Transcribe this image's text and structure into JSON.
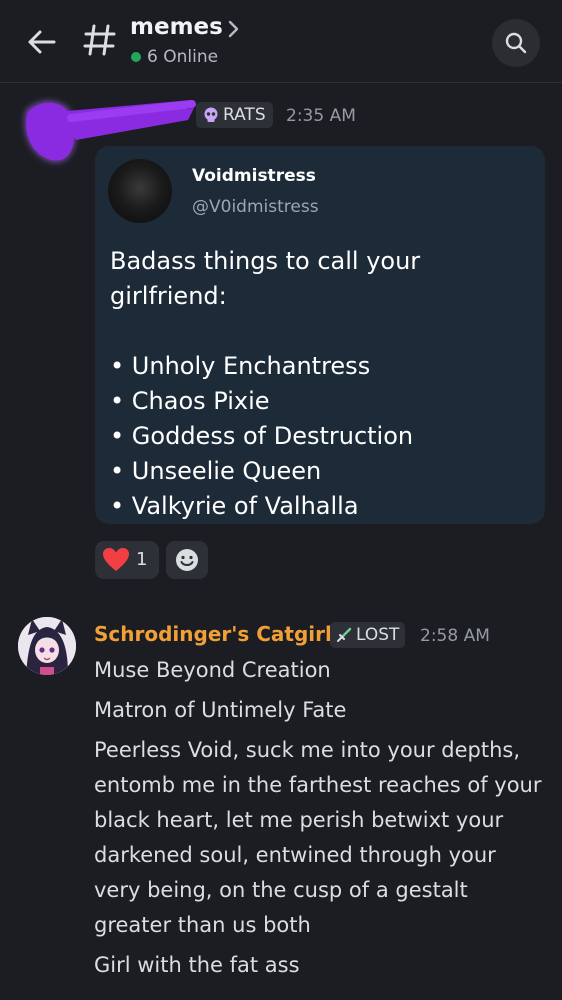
{
  "header": {
    "channel_name": "memes",
    "online_text": "6 Online"
  },
  "messages": [
    {
      "role": "RATS",
      "time": "2:35 AM",
      "embed": {
        "name": "Voidmistress",
        "handle": "@V0idmistress",
        "intro": "Badass things to call your girlfriend:",
        "items": [
          "Unholy Enchantress",
          "Chaos Pixie",
          "Goddess of Destruction",
          "Unseelie Queen",
          "Valkyrie of Valhalla"
        ]
      },
      "reaction": {
        "emoji": "heart",
        "count": "1"
      }
    },
    {
      "author": "Schrodinger's Catgirl",
      "role": "LOST",
      "time": "2:58 AM",
      "lines": [
        "Muse Beyond Creation",
        "Matron of Untimely Fate",
        "Peerless Void, suck me into your depths, entomb me in the farthest reaches of your black heart, let me perish betwixt your darkened soul, entwined through your very being, on the cusp of a gestalt greater than us both",
        "Girl with the fat ass"
      ]
    }
  ],
  "colors": {
    "background": "#1c1d23",
    "embed_bg": "#1d2a37",
    "author2": "#f0a036",
    "scribble": "#8a2be2",
    "online": "#23a55a"
  }
}
